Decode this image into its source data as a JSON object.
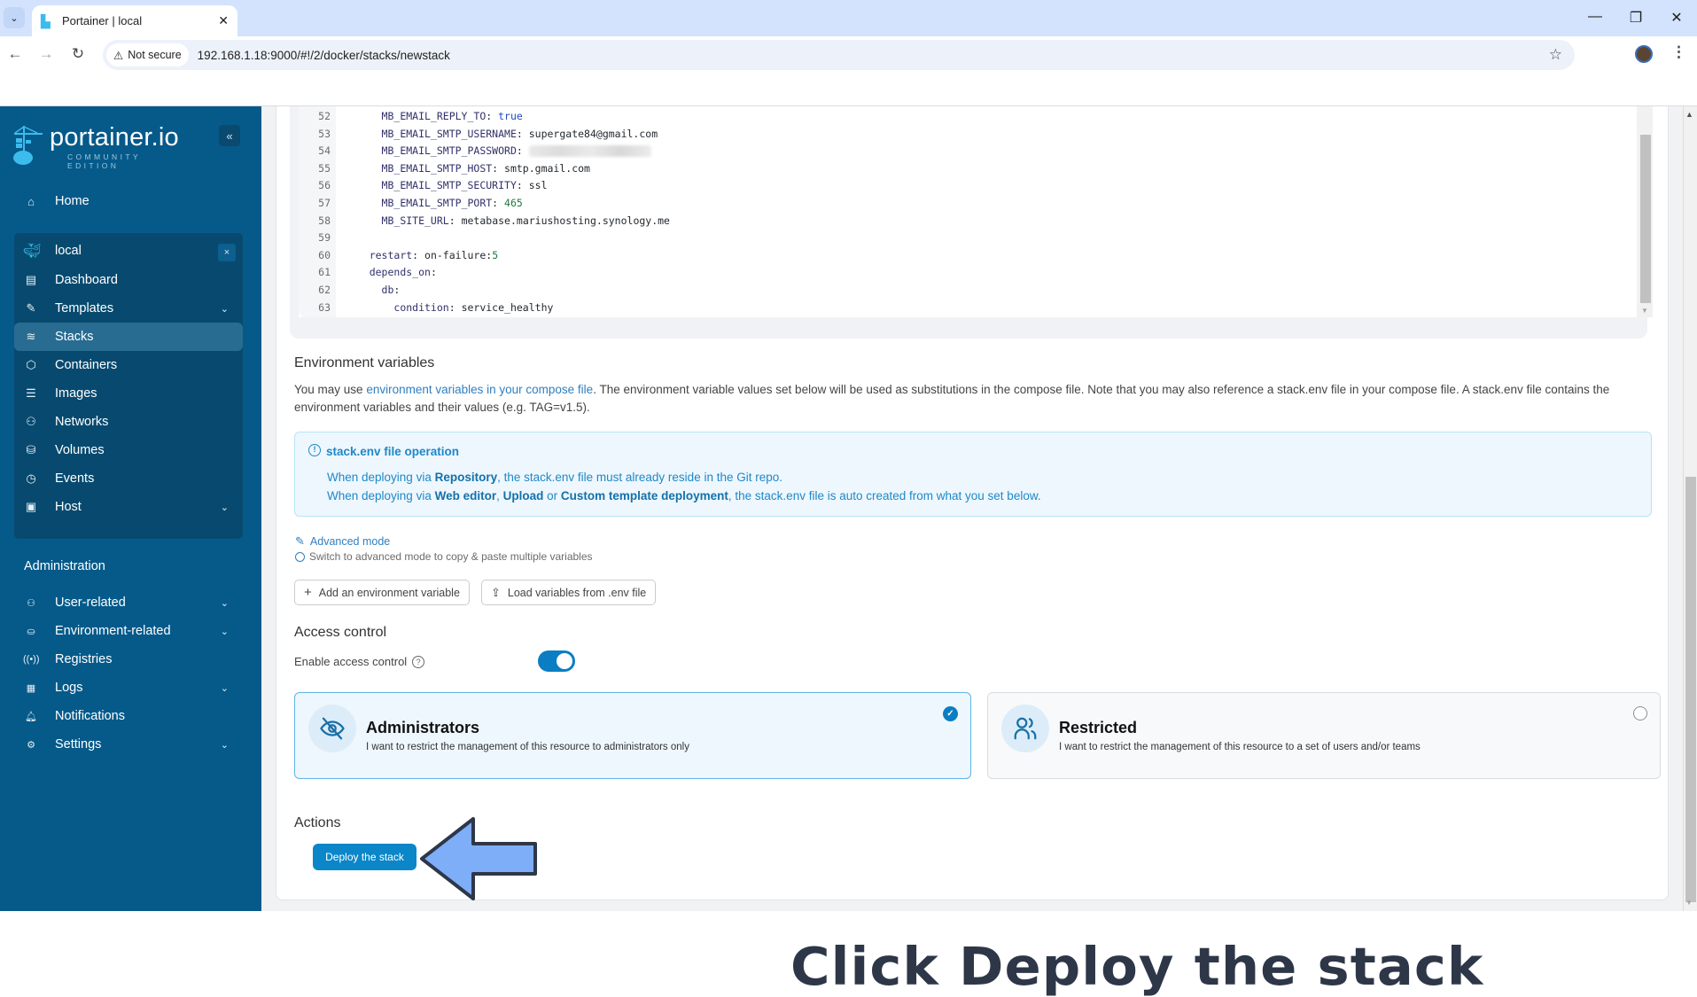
{
  "browser": {
    "tab_title": "Portainer | local",
    "not_secure_label": "Not secure",
    "url": "192.168.1.18:9000/#!/2/docker/stacks/newstack",
    "window_controls": {
      "minimize": "—",
      "restore": "❐",
      "close": "✕"
    },
    "icons": {
      "back": "←",
      "forward": "→",
      "reload": "↻",
      "star": "☆",
      "menu": "⋮",
      "tab_list": "⌄",
      "tab_close": "✕",
      "warning": "⚠"
    }
  },
  "sidebar": {
    "logo_word": "portainer.io",
    "logo_sub": "COMMUNITY EDITION",
    "collapse_icon": "«",
    "home": {
      "label": "Home",
      "icon": "⌂"
    },
    "environment": {
      "name": "local",
      "close_icon": "×"
    },
    "env_items": [
      {
        "label": "Dashboard",
        "icon": "▤",
        "chevron": ""
      },
      {
        "label": "Templates",
        "icon": "✎",
        "chevron": "⌄"
      },
      {
        "label": "Stacks",
        "icon": "≋",
        "chevron": "",
        "active": true
      },
      {
        "label": "Containers",
        "icon": "⬡",
        "chevron": ""
      },
      {
        "label": "Images",
        "icon": "☰",
        "chevron": ""
      },
      {
        "label": "Networks",
        "icon": "⚇",
        "chevron": ""
      },
      {
        "label": "Volumes",
        "icon": "⛁",
        "chevron": ""
      },
      {
        "label": "Events",
        "icon": "◷",
        "chevron": ""
      },
      {
        "label": "Host",
        "icon": "▣",
        "chevron": "⌄"
      }
    ],
    "admin_title": "Administration",
    "admin_items": [
      {
        "label": "User-related",
        "icon": "⚇",
        "chevron": "⌄"
      },
      {
        "label": "Environment-related",
        "icon": "⛀",
        "chevron": "⌄"
      },
      {
        "label": "Registries",
        "icon": "((•))",
        "chevron": ""
      },
      {
        "label": "Logs",
        "icon": "▦",
        "chevron": "⌄"
      },
      {
        "label": "Notifications",
        "icon": "🔔︎",
        "chevron": ""
      },
      {
        "label": "Settings",
        "icon": "⚙",
        "chevron": "⌄"
      }
    ]
  },
  "editor": {
    "lines": [
      {
        "n": "52",
        "indent": "      ",
        "key": "MB_EMAIL_REPLY_TO",
        "value": "true",
        "vtype": "b"
      },
      {
        "n": "53",
        "indent": "      ",
        "key": "MB_EMAIL_SMTP_USERNAME",
        "value": "supergate84@gmail.com",
        "vtype": "s"
      },
      {
        "n": "54",
        "indent": "      ",
        "key": "MB_EMAIL_SMTP_PASSWORD",
        "value": "",
        "vtype": "blur"
      },
      {
        "n": "55",
        "indent": "      ",
        "key": "MB_EMAIL_SMTP_HOST",
        "value": "smtp.gmail.com",
        "vtype": "s"
      },
      {
        "n": "56",
        "indent": "      ",
        "key": "MB_EMAIL_SMTP_SECURITY",
        "value": "ssl",
        "vtype": "s"
      },
      {
        "n": "57",
        "indent": "      ",
        "key": "MB_EMAIL_SMTP_PORT",
        "value": "465",
        "vtype": "n"
      },
      {
        "n": "58",
        "indent": "      ",
        "key": "MB_SITE_URL",
        "value": "metabase.mariushosting.synology.me",
        "vtype": "s"
      },
      {
        "n": "59",
        "indent": "",
        "key": "",
        "value": "",
        "vtype": "empty"
      },
      {
        "n": "60",
        "indent": "    ",
        "key": "restart",
        "value": "on-failure:5",
        "vtype": "s"
      },
      {
        "n": "61",
        "indent": "    ",
        "key": "depends_on",
        "value": "",
        "vtype": "s"
      },
      {
        "n": "62",
        "indent": "      ",
        "key": "db",
        "value": "",
        "vtype": "s"
      },
      {
        "n": "63",
        "indent": "        ",
        "key": "condition",
        "value": "service_healthy",
        "vtype": "s"
      }
    ]
  },
  "env_vars": {
    "title": "Environment variables",
    "desc_prefix": "You may use ",
    "desc_link": "environment variables in your compose file",
    "desc_suffix": ". The environment variable values set below will be used as substitutions in the compose file. Note that you may also reference a stack.env file in your compose file. A stack.env file contains the environment variables and their values (e.g. TAG=v1.5).",
    "info": {
      "title": "stack.env file operation",
      "line1_a": "When deploying via ",
      "line1_b": "Repository",
      "line1_c": ", the stack.env file must already reside in the Git repo.",
      "line2_a": "When deploying via ",
      "line2_b": "Web editor",
      "line2_c": ", ",
      "line2_d": "Upload",
      "line2_e": " or ",
      "line2_f": "Custom template deployment",
      "line2_g": ", the stack.env file is auto created from what you set below."
    },
    "advanced_mode": "Advanced mode",
    "advanced_hint": "Switch to advanced mode to copy & paste multiple variables",
    "add_button": "Add an environment variable",
    "load_button": "Load variables from .env file"
  },
  "access_control": {
    "title": "Access control",
    "enable_label": "Enable access control",
    "enabled": true,
    "options": [
      {
        "title": "Administrators",
        "desc": "I want to restrict the management of this resource to administrators only",
        "selected": true
      },
      {
        "title": "Restricted",
        "desc": "I want to restrict the management of this resource to a set of users and/or teams",
        "selected": false
      }
    ]
  },
  "actions": {
    "title": "Actions",
    "deploy_button": "Deploy the stack"
  },
  "annotation": {
    "text": "Click Deploy the stack",
    "arrow_color": "#7eaef8",
    "text_color": "#2e3748"
  }
}
